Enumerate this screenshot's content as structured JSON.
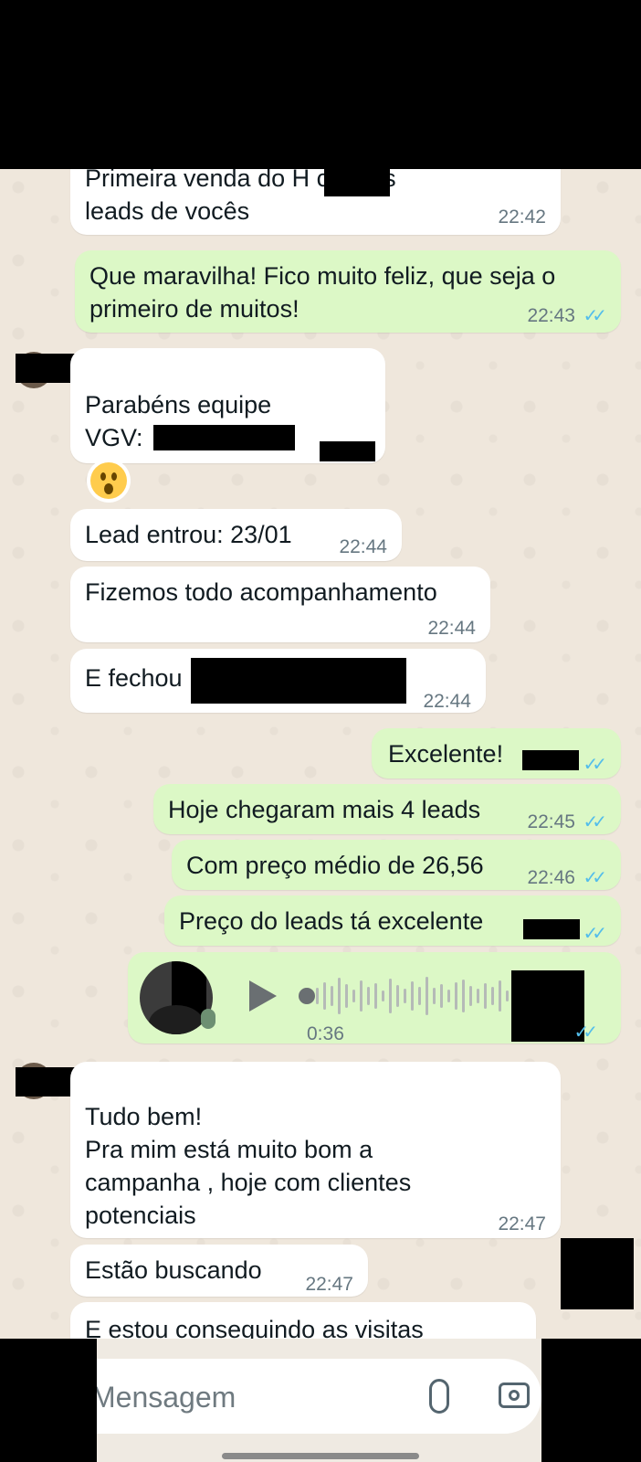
{
  "messages": [
    {
      "text": "Primeira venda do H       com os\nleads de vocês",
      "time": "22:42"
    },
    {
      "text": "Que maravilha! Fico muito feliz, que seja o\nprimeiro de muitos!",
      "time": "22:43"
    },
    {
      "text": "Parabéns equipe\nVGV:",
      "time": ""
    },
    {
      "text": "Lead entrou: 23/01",
      "time": "22:44"
    },
    {
      "text": "Fizemos todo acompanhamento",
      "time": "22:44"
    },
    {
      "text": "E fechou",
      "time": "22:44"
    },
    {
      "text": "Excelente!",
      "time": ""
    },
    {
      "text": "Hoje chegaram mais 4 leads",
      "time": "22:45"
    },
    {
      "text": "Com preço médio de 26,56",
      "time": "22:46"
    },
    {
      "text": "Preço do leads tá excelente",
      "time": ""
    },
    {
      "text": "Tudo bem!\nPra mim está muito bom a\ncampanha , hoje com clientes\npotenciais",
      "time": "22:47"
    },
    {
      "text": "Estão buscando",
      "time": "22:47"
    },
    {
      "text": "E estou conseguindo as visitas",
      "time": ""
    }
  ],
  "voice_message": {
    "duration": "0:36"
  },
  "input": {
    "placeholder": "Mensagem"
  },
  "icons": {
    "ticks": "✓✓",
    "attach": "paperclip-icon",
    "camera": "camera-icon"
  }
}
